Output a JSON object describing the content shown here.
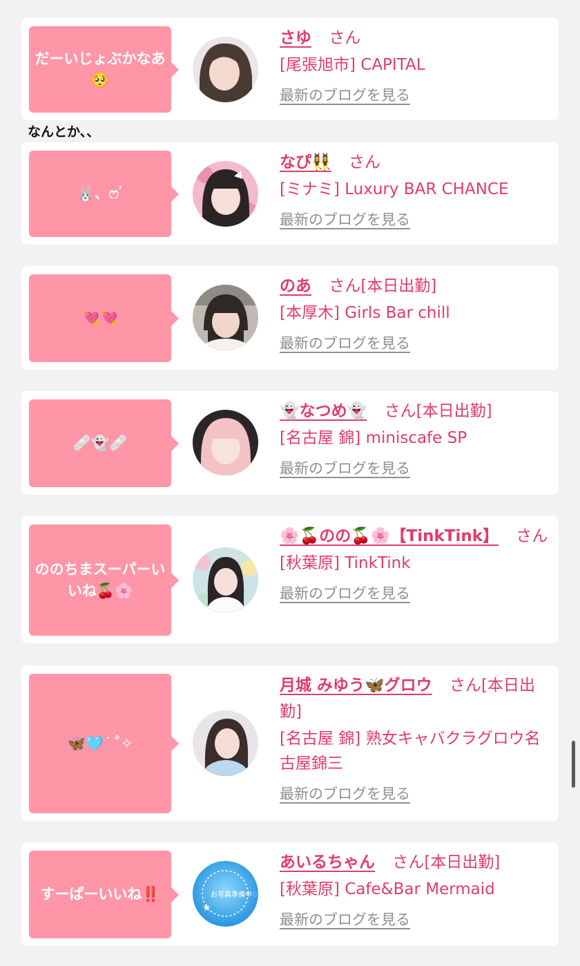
{
  "comment_label": "なんとか、、",
  "suffix_san": "さん",
  "blog_label": "最新のブログを見る",
  "colors": {
    "accent": "#e23b67",
    "bubble": "#ff96a8",
    "link_gray": "#8f8f8f",
    "background": "#f2f2f2"
  },
  "cards": [
    {
      "bubble": "だーいじょぶかなあ🥺",
      "name": "さゆ",
      "status": "",
      "shop": "[尾張旭市] CAPITAL"
    },
    {
      "bubble": "🐰、ෆ ͗",
      "name": "なぴ👯‍♀️",
      "status": "",
      "shop": "[ミナミ] Luxury BAR CHANCE"
    },
    {
      "bubble": "💘💘",
      "name": "のあ",
      "status": "[本日出勤]",
      "shop": "[本厚木] Girls Bar chill"
    },
    {
      "bubble": "🩹👻🩹",
      "name": "👻なつめ👻",
      "status": "[本日出勤]",
      "shop": "[名古屋 錦] miniscafe SP"
    },
    {
      "bubble": "ののちまスーパーいいね🍒🌸",
      "name": "🌸🍒のの🍒🌸【TinkTink】",
      "status": "",
      "shop": "[秋葉原] TinkTink"
    },
    {
      "bubble": "🦋🩵 ͘ ˚✧",
      "name": "月城 みゆう🦋グロウ",
      "status": "[本日出勤]",
      "shop": "[名古屋 錦] 熟女キャバクラグロウ名古屋錦三"
    },
    {
      "bubble": "すーぱーいいね‼️",
      "name": "あいるちゃん",
      "status": "[本日出勤]",
      "shop": "[秋葉原] Cafe&Bar Mermaid"
    }
  ],
  "avatar_7_text": "お写真準備中♡"
}
